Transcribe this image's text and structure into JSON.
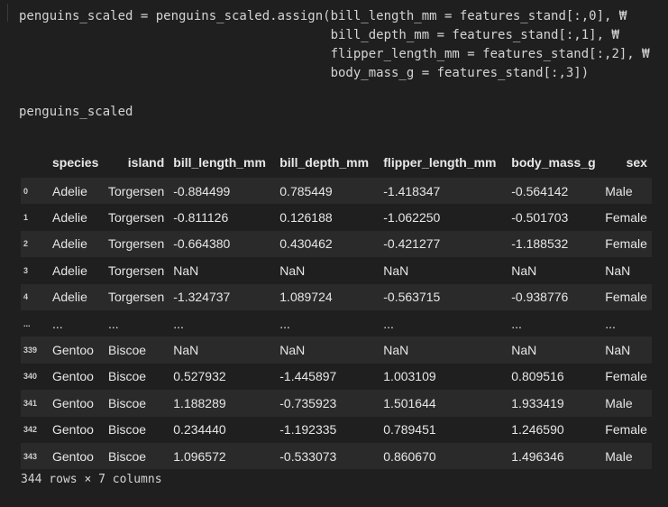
{
  "code": {
    "lines": [
      "penguins_scaled = penguins_scaled.assign(bill_length_mm = features_stand[:,0], ₩",
      "                                         bill_depth_mm = features_stand[:,1], ₩",
      "                                         flipper_length_mm = features_stand[:,2], ₩",
      "                                         body_mass_g = features_stand[:,3])",
      "",
      "penguins_scaled"
    ]
  },
  "table": {
    "columns": [
      "",
      "species",
      "island",
      "bill_length_mm",
      "bill_depth_mm",
      "flipper_length_mm",
      "body_mass_g",
      "sex"
    ],
    "rows": [
      [
        "0",
        "Adelie",
        "Torgersen",
        "-0.884499",
        "0.785449",
        "-1.418347",
        "-0.564142",
        "Male"
      ],
      [
        "1",
        "Adelie",
        "Torgersen",
        "-0.811126",
        "0.126188",
        "-1.062250",
        "-0.501703",
        "Female"
      ],
      [
        "2",
        "Adelie",
        "Torgersen",
        "-0.664380",
        "0.430462",
        "-0.421277",
        "-1.188532",
        "Female"
      ],
      [
        "3",
        "Adelie",
        "Torgersen",
        "NaN",
        "NaN",
        "NaN",
        "NaN",
        "NaN"
      ],
      [
        "4",
        "Adelie",
        "Torgersen",
        "-1.324737",
        "1.089724",
        "-0.563715",
        "-0.938776",
        "Female"
      ],
      [
        "...",
        "...",
        "...",
        "...",
        "...",
        "...",
        "...",
        "..."
      ],
      [
        "339",
        "Gentoo",
        "Biscoe",
        "NaN",
        "NaN",
        "NaN",
        "NaN",
        "NaN"
      ],
      [
        "340",
        "Gentoo",
        "Biscoe",
        "0.527932",
        "-1.445897",
        "1.003109",
        "0.809516",
        "Female"
      ],
      [
        "341",
        "Gentoo",
        "Biscoe",
        "1.188289",
        "-0.735923",
        "1.501644",
        "1.933419",
        "Male"
      ],
      [
        "342",
        "Gentoo",
        "Biscoe",
        "0.234440",
        "-1.192335",
        "0.789451",
        "1.246590",
        "Female"
      ],
      [
        "343",
        "Gentoo",
        "Biscoe",
        "1.096572",
        "-0.533073",
        "0.860670",
        "1.496346",
        "Male"
      ]
    ]
  },
  "footer": {
    "shape_text": "344 rows × 7 columns"
  }
}
